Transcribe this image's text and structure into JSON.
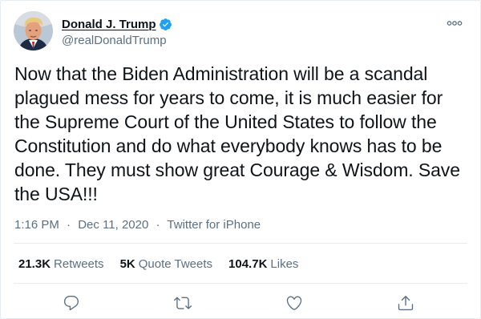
{
  "author": {
    "display_name": "Donald J. Trump",
    "handle": "@realDonaldTrump",
    "verified": true
  },
  "tweet": {
    "text": "Now that the Biden Administration will be a scandal plagued mess for years to come, it is much easier for the Supreme Court of the United States to follow the Constitution and do what everybody knows has to be done. They must show great Courage & Wisdom. Save the USA!!!",
    "time": "1:16 PM",
    "date": "Dec 11, 2020",
    "separator": "·",
    "source": "Twitter for iPhone"
  },
  "stats": {
    "retweets_count": "21.3K",
    "retweets_label": "Retweets",
    "quotes_count": "5K",
    "quotes_label": "Quote Tweets",
    "likes_count": "104.7K",
    "likes_label": "Likes"
  },
  "icons": {
    "more": "more-icon",
    "reply": "reply-icon",
    "retweet": "retweet-icon",
    "like": "heart-icon",
    "share": "share-icon",
    "verified": "verified-badge-icon"
  },
  "colors": {
    "primary_text": "#0f1419",
    "secondary_text": "#5b7083",
    "verified_blue": "#1da1f2",
    "border": "#e6ecf0"
  }
}
